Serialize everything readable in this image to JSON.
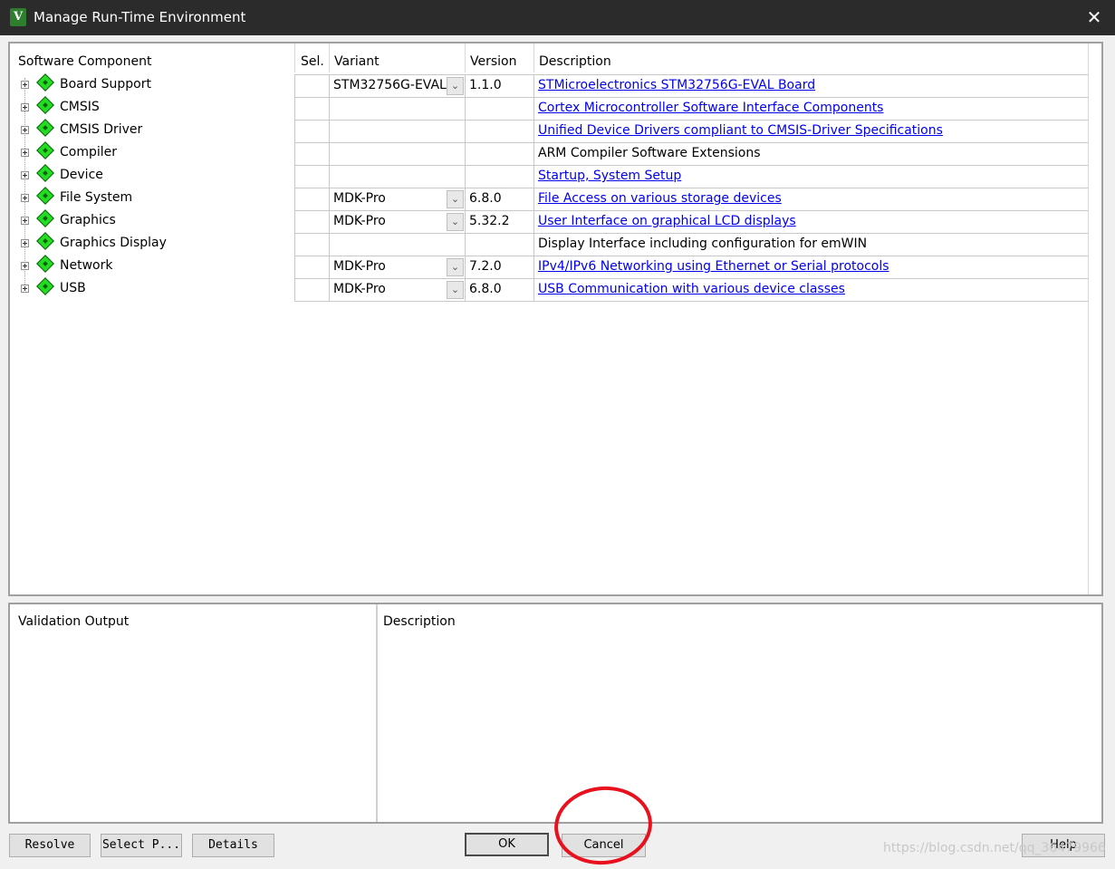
{
  "window": {
    "title": "Manage Run-Time Environment",
    "close_glyph": "✕",
    "app_icon_letter": "V"
  },
  "columns": {
    "component": "Software Component",
    "sel": "Sel.",
    "variant": "Variant",
    "version": "Version",
    "description": "Description"
  },
  "components": [
    {
      "name": "Board Support",
      "sel": "",
      "variant": "STM32756G-EVAL",
      "has_dropdown": true,
      "version": "1.1.0",
      "description": "STMicroelectronics STM32756G-EVAL Board",
      "link": true
    },
    {
      "name": "CMSIS",
      "sel": "",
      "variant": "",
      "has_dropdown": false,
      "version": "",
      "description": "Cortex Microcontroller Software Interface Components",
      "link": true
    },
    {
      "name": "CMSIS Driver",
      "sel": "",
      "variant": "",
      "has_dropdown": false,
      "version": "",
      "description": "Unified Device Drivers compliant to CMSIS-Driver Specifications",
      "link": true
    },
    {
      "name": "Compiler",
      "sel": "",
      "variant": "",
      "has_dropdown": false,
      "version": "",
      "description": "ARM Compiler Software Extensions",
      "link": false
    },
    {
      "name": "Device",
      "sel": "",
      "variant": "",
      "has_dropdown": false,
      "version": "",
      "description": "Startup, System Setup",
      "link": true
    },
    {
      "name": "File System",
      "sel": "",
      "variant": "MDK-Pro",
      "has_dropdown": true,
      "version": "6.8.0",
      "description": "File Access on various storage devices",
      "link": true
    },
    {
      "name": "Graphics",
      "sel": "",
      "variant": "MDK-Pro",
      "has_dropdown": true,
      "version": "5.32.2",
      "description": "User Interface on graphical LCD displays",
      "link": true
    },
    {
      "name": "Graphics Display",
      "sel": "",
      "variant": "",
      "has_dropdown": false,
      "version": "",
      "description": "Display Interface including configuration for emWIN",
      "link": false
    },
    {
      "name": "Network",
      "sel": "",
      "variant": "MDK-Pro",
      "has_dropdown": true,
      "version": "7.2.0",
      "description": "IPv4/IPv6 Networking using Ethernet or Serial protocols",
      "link": true
    },
    {
      "name": "USB",
      "sel": "",
      "variant": "MDK-Pro",
      "has_dropdown": true,
      "version": "6.8.0",
      "description": "USB Communication with various device classes",
      "link": true
    }
  ],
  "validation": {
    "output_header": "Validation Output",
    "description_header": "Description"
  },
  "buttons": {
    "resolve": "Resolve",
    "select_packs": "Select P...",
    "details": "Details",
    "ok": "OK",
    "cancel": "Cancel",
    "help": "Help"
  },
  "watermark": "https://blog.csdn.net/qq_36479966",
  "annotation_color": "#e8121e"
}
